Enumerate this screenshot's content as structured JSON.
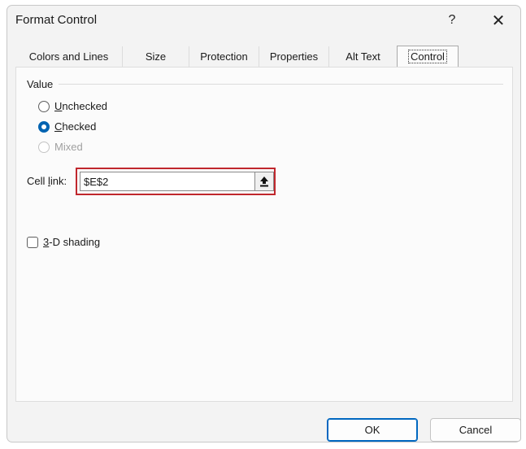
{
  "dialog": {
    "title": "Format Control",
    "help_glyph": "?",
    "close_glyph": "✕"
  },
  "tabs": [
    {
      "label": "Colors and Lines",
      "active": false
    },
    {
      "label": "Size",
      "active": false
    },
    {
      "label": "Protection",
      "active": false
    },
    {
      "label": "Properties",
      "active": false
    },
    {
      "label": "Alt Text",
      "active": false
    },
    {
      "label": "Control",
      "active": true
    }
  ],
  "control": {
    "value_group_label": "Value",
    "options": [
      {
        "label_accel": "U",
        "label_rest": "nchecked",
        "state": "unchecked"
      },
      {
        "label_accel": "C",
        "label_rest": "hecked",
        "state": "checked"
      },
      {
        "label": "Mixed",
        "state": "disabled"
      }
    ],
    "cell_link_label_pre": "Cell ",
    "cell_link_label_accel": "l",
    "cell_link_label_post": "ink:",
    "cell_link_value": "$E$2",
    "shading_accel": "3",
    "shading_rest": "-D shading",
    "shading_checked": false
  },
  "buttons": {
    "ok": "OK",
    "cancel": "Cancel"
  },
  "colors": {
    "accent": "#0067c0",
    "highlight_border": "#c0272d"
  }
}
